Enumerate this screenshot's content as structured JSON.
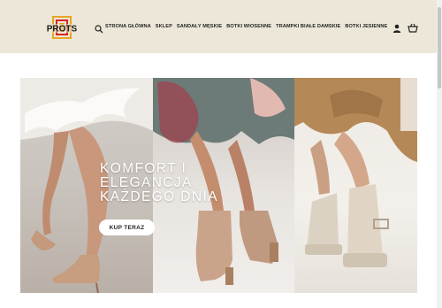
{
  "brand": {
    "logo_text": "PROTS"
  },
  "nav": {
    "items": [
      {
        "label": "STRONA GŁÓWNA"
      },
      {
        "label": "SKLEP"
      },
      {
        "label": "SANDAŁY MĘSKIE"
      },
      {
        "label": "BOTKI WIOSENNE"
      },
      {
        "label": "TRAMPKI BIAŁE DAMSKIE"
      },
      {
        "label": "BOTKI JESIENNE"
      }
    ]
  },
  "header": {
    "icons": [
      "search-icon",
      "user-icon",
      "cart-icon"
    ]
  },
  "hero": {
    "title_lines": [
      "KOMFORT I",
      "ELEGANCJA",
      "KAŻDEGO DNIA"
    ],
    "cta_label": "KUP TERAZ"
  },
  "colors": {
    "header_bg": "#ede7d9",
    "logo_red": "#d9231f",
    "logo_gold": "#e8a525",
    "text_dark": "#222222"
  }
}
